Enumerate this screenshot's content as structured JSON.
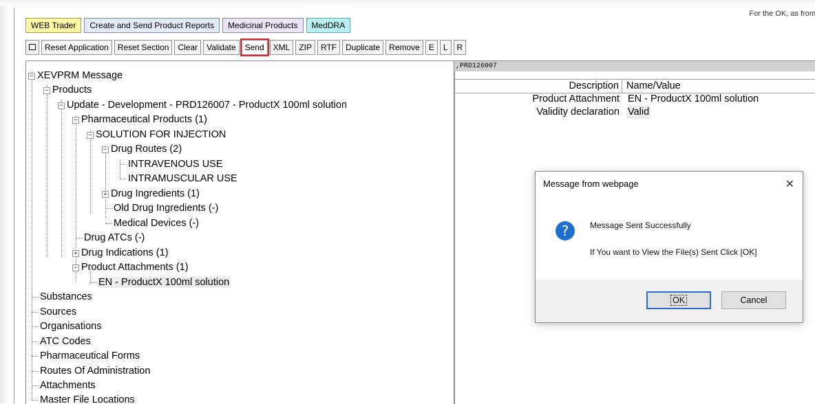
{
  "top_note": "For the OK, as from",
  "tabs": [
    "WEB Trader",
    "Create and Send Product Reports",
    "Medicinal Products",
    "MedDRA"
  ],
  "toolbar": {
    "buttons": [
      "Reset Application",
      "Reset Section",
      "Clear",
      "Validate",
      "Send",
      "XML",
      "ZIP",
      "RTF",
      "Duplicate",
      "Remove",
      "E",
      "L",
      "R"
    ],
    "highlighted": "Send"
  },
  "tree": {
    "root": "XEVPRM Message",
    "products": "Products",
    "update": "Update - Development - PRD126007 - ProductX 100ml solution",
    "pharm_products": "Pharmaceutical Products (1)",
    "solution": "SOLUTION FOR INJECTION",
    "drug_routes": "Drug Routes (2)",
    "intravenous": "INTRAVENOUS USE",
    "intramuscular": "INTRAMUSCULAR USE",
    "drug_ingredients": "Drug Ingredients (1)",
    "old_drug_ingredients": "Old Drug Ingredients (-)",
    "medical_devices": "Medical Devices (-)",
    "drug_atcs": "Drug ATCs (-)",
    "drug_indications": "Drug Indications (1)",
    "product_attachments": "Product Attachments (1)",
    "attachment_en": "EN - ProductX 100ml solution",
    "substances": "Substances",
    "sources": "Sources",
    "organisations": "Organisations",
    "atc_codes": "ATC Codes",
    "pharmaceutical_forms": "Pharmaceutical Forms",
    "routes_of_administration": "Routes Of Administration",
    "attachments": "Attachments",
    "master_file_locations": "Master File Locations"
  },
  "details": {
    "header": ",PRD126007",
    "col_description": "Description",
    "col_name_value": "Name/Value",
    "rows": [
      {
        "description": "Product Attachment",
        "value": "EN - ProductX 100ml solution"
      },
      {
        "description": "Validity declaration",
        "value": "Valid"
      }
    ]
  },
  "dialog": {
    "title": "Message from webpage",
    "message": "Message Sent Successfully",
    "submessage": "If You want to View the File(s) Sent Click [OK]",
    "ok_label": "OK",
    "cancel_label": "Cancel",
    "close_glyph": "✕",
    "icon_glyph": "?"
  },
  "colors": {
    "highlight": "#d8282f",
    "dialog_icon": "#1f6fd1",
    "webtrader_tab": "#fff7a8",
    "meddra_tab": "#b9f0f2"
  }
}
